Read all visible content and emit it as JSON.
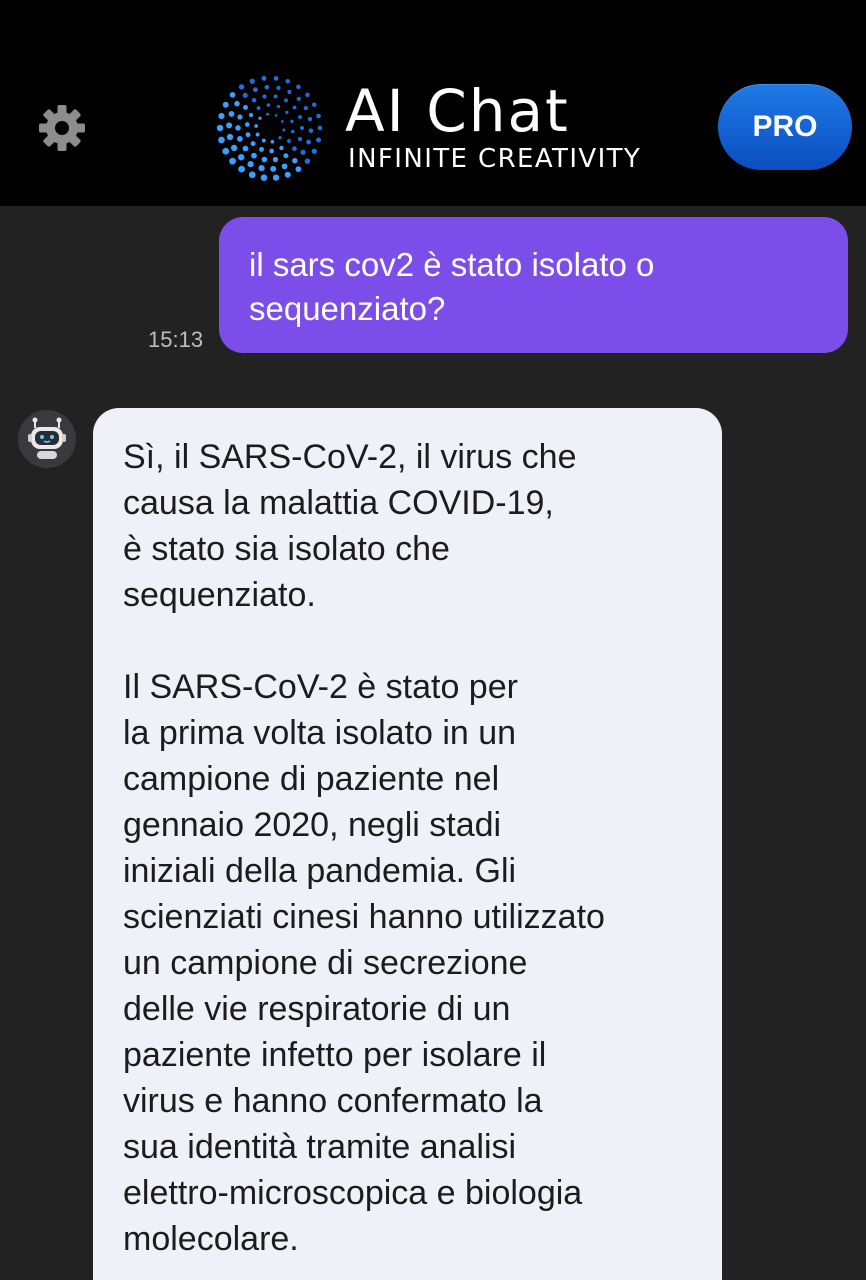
{
  "header": {
    "title": "AI Chat",
    "subtitle": "INFINITE CREATIVITY",
    "pro_label": "PRO",
    "settings_icon": "gear-icon",
    "logo_icon": "dotted-sphere-logo"
  },
  "colors": {
    "header_bg": "#000000",
    "chat_bg": "#222222",
    "user_bubble": "#7b4de9",
    "bot_bubble": "#eef1f8",
    "pro_button": "#1565d8"
  },
  "messages": [
    {
      "role": "user",
      "text": "il sars cov2 è stato isolato o\nsequenziato?",
      "time": "15:13"
    },
    {
      "role": "bot",
      "avatar_icon": "robot-icon",
      "paragraphs": [
        "Sì, il SARS-CoV-2, il virus che\ncausa la malattia COVID-19,\nè stato sia isolato che\nsequenziato.",
        "Il SARS-CoV-2 è stato per\nla prima volta isolato in un\ncampione di paziente nel\ngennaio 2020, negli stadi\niniziali della pandemia. Gli\nscienziati cinesi hanno utilizzato\nun campione di secrezione\ndelle vie respiratorie di un\npaziente infetto per isolare il\nvirus e hanno confermato la\nsua identità tramite analisi\nelettro-microscopica e biologia\nmolecolare."
      ]
    }
  ]
}
